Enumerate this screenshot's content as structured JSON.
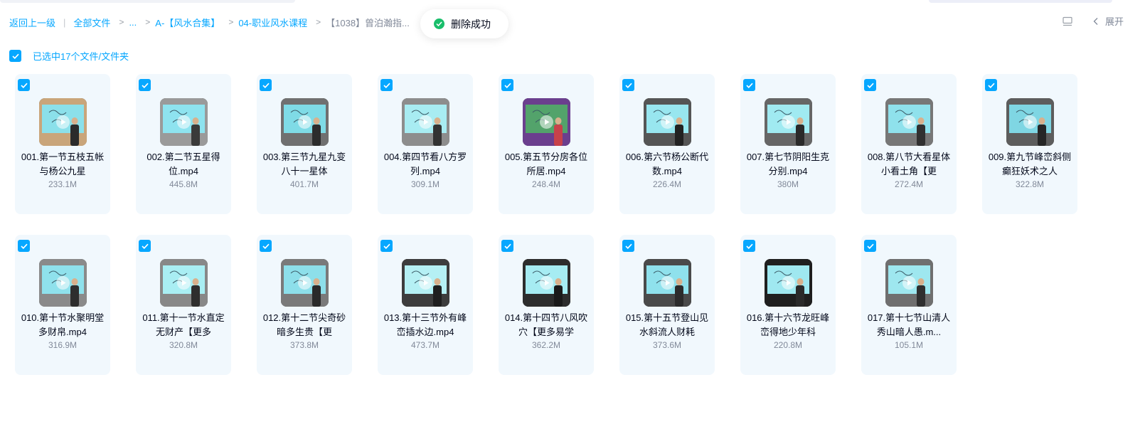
{
  "breadcrumb": {
    "back": "返回上一级",
    "all_files": "全部文件",
    "ellipsis": "...",
    "folder1": "A-【风水合集】",
    "folder2": "04-职业风水课程",
    "current": "【1038】曾泊瀚指..."
  },
  "toast": {
    "text": "删除成功",
    "icon": "check-circle-icon"
  },
  "toolbar": {
    "expand_label": "展开",
    "view_icon": "list-view-icon"
  },
  "selection": {
    "text": "已选中17个文件/文件夹"
  },
  "colors": {
    "accent": "#06a7ff",
    "card_bg": "#f1f8fd",
    "success": "#19be6b"
  },
  "files": [
    {
      "name": "001.第一节五枝五帐与杨公九星",
      "size": "233.1M"
    },
    {
      "name": "002.第二节五星得位.mp4",
      "size": "445.8M"
    },
    {
      "name": "003.第三节九星九变八十一星体",
      "size": "401.7M"
    },
    {
      "name": "004.第四节看八方罗列.mp4",
      "size": "309.1M"
    },
    {
      "name": "005.第五节分房各位所居.mp4",
      "size": "248.4M"
    },
    {
      "name": "006.第六节杨公断代数.mp4",
      "size": "226.4M"
    },
    {
      "name": "007.第七节阴阳生克分别.mp4",
      "size": "380M"
    },
    {
      "name": "008.第八节大看星体小看土角【更",
      "size": "272.4M"
    },
    {
      "name": "009.第九节峰峦斜侧癫狂妖术之人",
      "size": "322.8M"
    },
    {
      "name": "010.第十节水聚明堂多财帛.mp4",
      "size": "316.9M"
    },
    {
      "name": "011.第十一节水直定无财产【更多",
      "size": "320.8M"
    },
    {
      "name": "012.第十二节尖奇砂暗多生贵【更",
      "size": "373.8M"
    },
    {
      "name": "013.第十三节外有峰峦插水边.mp4",
      "size": "473.7M"
    },
    {
      "name": "014.第十四节八风吹穴【更多易学",
      "size": "362.2M"
    },
    {
      "name": "015.第十五节登山见水斜流人财耗",
      "size": "373.6M"
    },
    {
      "name": "016.第十六节龙旺峰峦得地少年科",
      "size": "220.8M"
    },
    {
      "name": "017.第十七节山清人秀山暗人愚.m...",
      "size": "105.1M"
    }
  ]
}
